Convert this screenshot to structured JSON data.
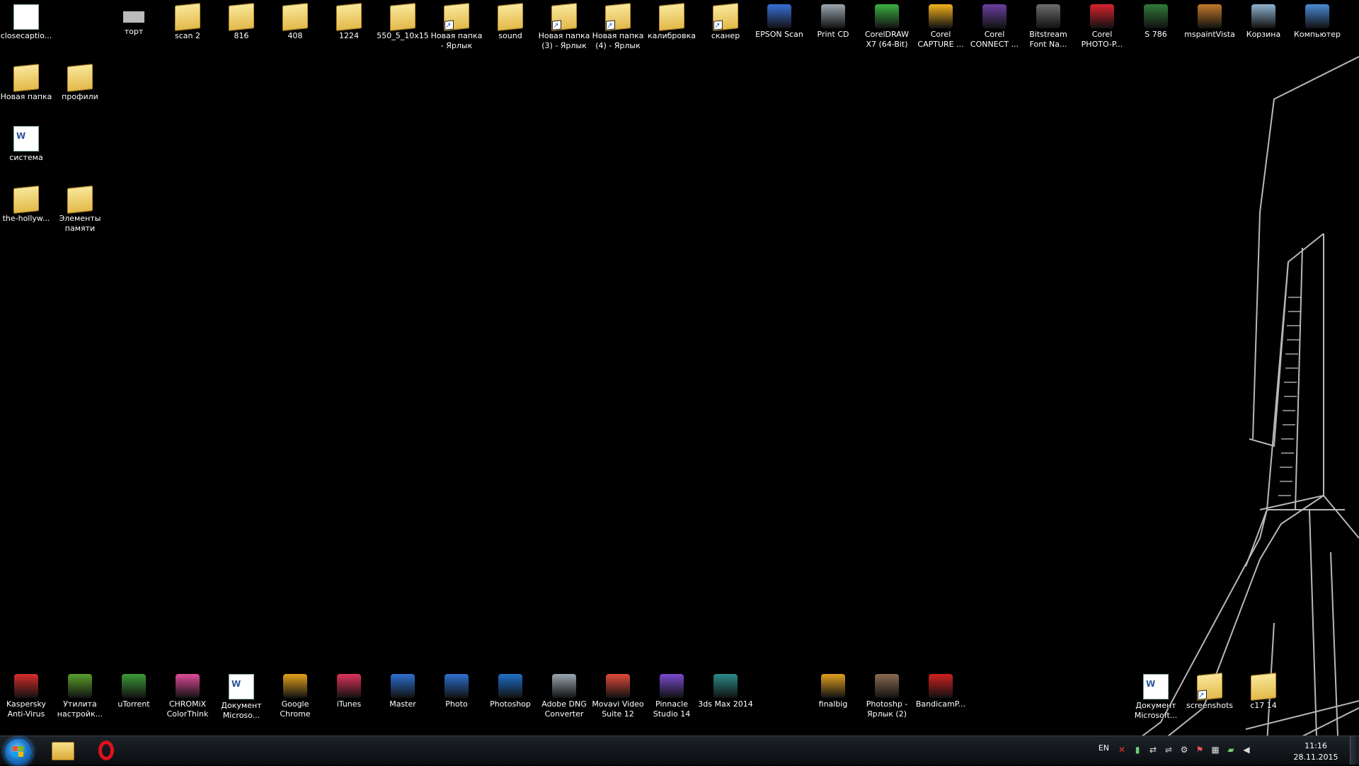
{
  "desktop": {
    "top_row": [
      {
        "name": "closecaptions-icon",
        "label": "closecaptio...",
        "kind": "doc"
      },
      {
        "name": "tort-icon",
        "label": "торт",
        "kind": "image"
      },
      {
        "name": "scan2-folder-icon",
        "label": "scan 2",
        "kind": "folder"
      },
      {
        "name": "folder-816-icon",
        "label": "816",
        "kind": "folder"
      },
      {
        "name": "folder-408-icon",
        "label": "408",
        "kind": "folder"
      },
      {
        "name": "folder-1224-icon",
        "label": "1224",
        "kind": "folder"
      },
      {
        "name": "folder-550-icon",
        "label": "550_5_10x15",
        "kind": "folder"
      },
      {
        "name": "new-folder-shortcut-icon",
        "label": "Новая папка\n- Ярлык",
        "kind": "folder-shortcut"
      },
      {
        "name": "sound-folder-icon",
        "label": "sound",
        "kind": "folder"
      },
      {
        "name": "new-folder-3-shortcut-icon",
        "label": "Новая папка\n(3) - Ярлык",
        "kind": "folder-shortcut"
      },
      {
        "name": "new-folder-4-shortcut-icon",
        "label": "Новая папка\n(4) - Ярлык",
        "kind": "folder-shortcut"
      },
      {
        "name": "calibration-folder-icon",
        "label": "калибровка",
        "kind": "folder"
      },
      {
        "name": "scanner-shortcut-icon",
        "label": "сканер",
        "kind": "folder-shortcut"
      },
      {
        "name": "epson-scan-icon",
        "label": "EPSON Scan",
        "kind": "app",
        "color": "#3a6fd8"
      },
      {
        "name": "print-cd-icon",
        "label": "Print CD",
        "kind": "app",
        "color": "#9aa6b0"
      },
      {
        "name": "coreldraw-icon",
        "label": "CorelDRAW\nX7 (64-Bit)",
        "kind": "app",
        "color": "#3bb143"
      },
      {
        "name": "corel-capture-icon",
        "label": "Corel\nCAPTURE ...",
        "kind": "app",
        "color": "#f2b21b"
      },
      {
        "name": "corel-connect-icon",
        "label": "Corel\nCONNECT ...",
        "kind": "app",
        "color": "#6a3fa0"
      },
      {
        "name": "bitstream-font-icon",
        "label": "Bitstream\nFont Na...",
        "kind": "app",
        "color": "#6c6c6c"
      },
      {
        "name": "corel-photopaint-icon",
        "label": "Corel\nPHOTO-P...",
        "kind": "app",
        "color": "#d9232e"
      },
      {
        "name": "s786-icon",
        "label": "S 786",
        "kind": "app",
        "color": "#2f7a3a"
      },
      {
        "name": "mspaint-icon",
        "label": "mspaintVista",
        "kind": "app",
        "color": "#c47a2a"
      },
      {
        "name": "recycle-bin-icon",
        "label": "Корзина",
        "kind": "app",
        "color": "#8fb3d1"
      },
      {
        "name": "computer-icon",
        "label": "Компьютер",
        "kind": "app",
        "color": "#4a8bd6"
      }
    ],
    "left_col": [
      {
        "name": "new-folder-icon",
        "label": "Новая папка",
        "kind": "folder"
      },
      {
        "name": "profiles-folder-icon",
        "label": "профили",
        "kind": "folder"
      },
      {
        "name": "system-doc-icon",
        "label": "система",
        "kind": "doc-word"
      },
      {
        "name": "hollywood-folder-icon",
        "label": "the-hollyw...",
        "kind": "folder"
      },
      {
        "name": "memory-folder-icon",
        "label": "Элементы\nпамяти",
        "kind": "folder"
      }
    ],
    "bottom_row": [
      {
        "name": "kaspersky-icon",
        "label": "Kaspersky\nAnti-Virus",
        "kind": "app",
        "color": "#d62c2c"
      },
      {
        "name": "nvidia-utility-icon",
        "label": "Утилита\nнастройк...",
        "kind": "app",
        "color": "#5aa02c"
      },
      {
        "name": "utorrent-icon",
        "label": "uTorrent",
        "kind": "app",
        "color": "#3c9a37"
      },
      {
        "name": "chromix-icon",
        "label": "CHROMiX\nColorThink",
        "kind": "app",
        "color": "#e04b9a"
      },
      {
        "name": "word-doc-icon",
        "label": "Документ\nMicroso...",
        "kind": "doc-word"
      },
      {
        "name": "google-chrome-icon",
        "label": "Google\nChrome",
        "kind": "app",
        "color": "#e3a21a"
      },
      {
        "name": "itunes-icon",
        "label": "iTunes",
        "kind": "app",
        "color": "#e0325a"
      },
      {
        "name": "master-icon",
        "label": "Master",
        "kind": "app",
        "color": "#2d6fcf"
      },
      {
        "name": "photo-icon",
        "label": "Photo",
        "kind": "app",
        "color": "#2d6fcf"
      },
      {
        "name": "photoshop-icon",
        "label": "Photoshop",
        "kind": "app",
        "color": "#1e6fc8"
      },
      {
        "name": "adobe-dng-icon",
        "label": "Adobe DNG\nConverter",
        "kind": "app",
        "color": "#9aa6b0"
      },
      {
        "name": "movavi-icon",
        "label": "Movavi Video\nSuite 12",
        "kind": "app",
        "color": "#e04a3a"
      },
      {
        "name": "pinnacle-icon",
        "label": "Pinnacle\nStudio 14",
        "kind": "app",
        "color": "#7a4ad0"
      },
      {
        "name": "3dsmax-icon",
        "label": "3ds Max 2014",
        "kind": "app",
        "color": "#2a8a8a"
      },
      {
        "name": "finalbig-icon",
        "label": "finalbig",
        "kind": "app",
        "color": "#e0a020"
      },
      {
        "name": "photoshop-shortcut-icon",
        "label": "Photoshp -\nЯрлык (2)",
        "kind": "app",
        "color": "#8a6a50"
      },
      {
        "name": "bandicam-icon",
        "label": "BandicamP...",
        "kind": "app",
        "color": "#d02020"
      },
      {
        "name": "ms-document-icon",
        "label": "Документ\nMicrosoft...",
        "kind": "doc-word"
      },
      {
        "name": "screenshots-folder-icon",
        "label": "screenshots",
        "kind": "folder-shortcut"
      },
      {
        "name": "c1714-folder-icon",
        "label": "c17 14",
        "kind": "folder"
      }
    ]
  },
  "taskbar": {
    "language": "EN",
    "time": "11:16",
    "date": "28.11.2015"
  }
}
